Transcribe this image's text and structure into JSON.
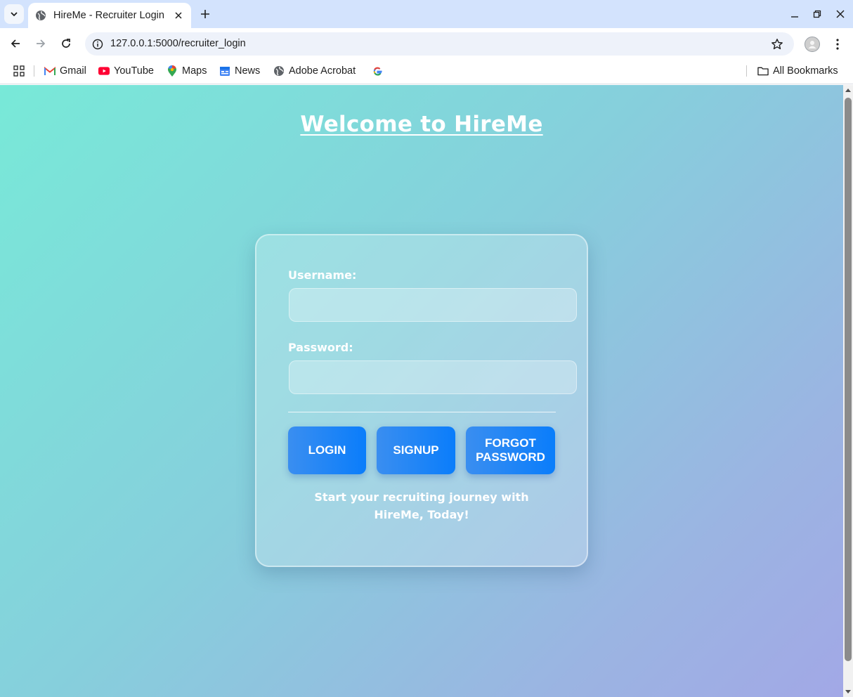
{
  "browser": {
    "tab_title": "HireMe - Recruiter Login",
    "url": "127.0.0.1:5000/recruiter_login",
    "bookmarks": [
      {
        "label": "Gmail",
        "icon": "gmail-icon"
      },
      {
        "label": "YouTube",
        "icon": "youtube-icon"
      },
      {
        "label": "Maps",
        "icon": "maps-icon"
      },
      {
        "label": "News",
        "icon": "news-icon"
      },
      {
        "label": "Adobe Acrobat",
        "icon": "globe-icon"
      }
    ],
    "all_bookmarks_label": "All Bookmarks"
  },
  "page": {
    "heading": "Welcome to HireMe",
    "form": {
      "username_label": "Username:",
      "username_value": "",
      "password_label": "Password:",
      "password_value": "",
      "login_label": "LOGIN",
      "signup_label": "SIGNUP",
      "forgot_label": "FORGOT PASSWORD"
    },
    "tagline": "Start your recruiting journey with HireMe, Today!"
  },
  "colors": {
    "gradient_start": "#78e9d8",
    "gradient_end": "#a2a8e6",
    "button_blue": "#0a7dfb",
    "text_white": "#ffffff"
  }
}
